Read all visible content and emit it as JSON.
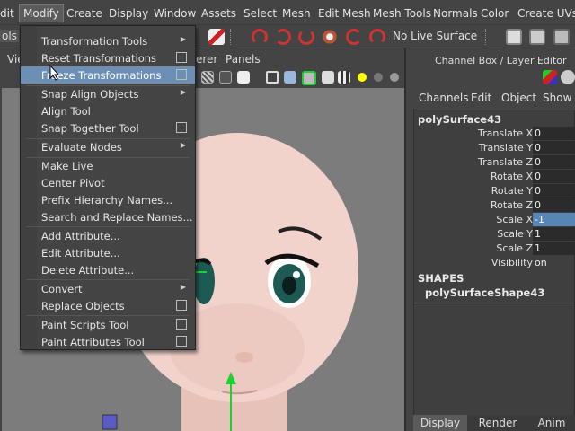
{
  "menubar": {
    "items": [
      "dit",
      "Modify",
      "Create",
      "Display",
      "Window",
      "Assets",
      "Select",
      "Mesh",
      "Edit Mesh",
      "Mesh Tools",
      "Normals",
      "Color",
      "Create UVs"
    ],
    "active": "Modify"
  },
  "statusbar": {
    "left_label": "ols",
    "live_surface": "No Live Surface"
  },
  "viewport_panel": {
    "menu": [
      "Vie",
      "erer",
      "Panels"
    ]
  },
  "modify_menu": {
    "items": [
      {
        "label": "Transformation Tools",
        "submenu": true,
        "option": false
      },
      {
        "label": "Reset Transformations",
        "submenu": false,
        "option": true
      },
      {
        "label": "Freeze Transformations",
        "submenu": false,
        "option": true,
        "highlighted": true
      },
      {
        "label": "Snap Align Objects",
        "submenu": true,
        "option": false
      },
      {
        "label": "Align Tool",
        "submenu": false,
        "option": false
      },
      {
        "label": "Snap Together Tool",
        "submenu": false,
        "option": true
      },
      {
        "label": "Evaluate Nodes",
        "submenu": true,
        "option": false
      },
      {
        "label": "Make Live",
        "submenu": false,
        "option": false
      },
      {
        "label": "Center Pivot",
        "submenu": false,
        "option": false
      },
      {
        "label": "Prefix Hierarchy Names...",
        "submenu": false,
        "option": false
      },
      {
        "label": "Search and Replace Names...",
        "submenu": false,
        "option": false
      },
      {
        "label": "Add Attribute...",
        "submenu": false,
        "option": false
      },
      {
        "label": "Edit Attribute...",
        "submenu": false,
        "option": false
      },
      {
        "label": "Delete Attribute...",
        "submenu": false,
        "option": false
      },
      {
        "label": "Convert",
        "submenu": true,
        "option": false
      },
      {
        "label": "Replace Objects",
        "submenu": false,
        "option": true
      },
      {
        "label": "Paint Scripts Tool",
        "submenu": false,
        "option": true
      },
      {
        "label": "Paint Attributes Tool",
        "submenu": false,
        "option": true
      }
    ]
  },
  "channel_box": {
    "title": "Channel Box / Layer Editor",
    "menu": [
      "Channels",
      "Edit",
      "Object",
      "Show"
    ],
    "object_name": "polySurface43",
    "attributes": [
      {
        "label": "Translate X",
        "value": "0"
      },
      {
        "label": "Translate Y",
        "value": "0"
      },
      {
        "label": "Translate Z",
        "value": "0"
      },
      {
        "label": "Rotate X",
        "value": "0"
      },
      {
        "label": "Rotate Y",
        "value": "0"
      },
      {
        "label": "Rotate Z",
        "value": "0"
      },
      {
        "label": "Scale X",
        "value": "-1",
        "selected": true
      },
      {
        "label": "Scale Y",
        "value": "1"
      },
      {
        "label": "Scale Z",
        "value": "1"
      },
      {
        "label": "Visibility",
        "value": "on"
      }
    ],
    "shapes_header": "SHAPES",
    "shape_name": "polySurfaceShape43",
    "tabs": [
      "Display",
      "Render",
      "Anim"
    ],
    "active_tab": "Display"
  },
  "icons": {
    "toolbar": [
      "snap-grid-icon",
      "snap-curve-icon",
      "snap-point-icon",
      "snap-view-icon",
      "make-live-icon",
      "render-icon",
      "ipr-icon",
      "render-settings-icon"
    ],
    "panel": [
      "wireframe-icon",
      "smooth-shade-icon",
      "xray-icon",
      "texture-icon",
      "light-icon",
      "shadow-icon"
    ]
  },
  "colors": {
    "menu_highlight": "#6e8fb4",
    "selected_value": "#5785b6",
    "viewport_bg": "#7c7c7c",
    "manipulator_green": "#19d233"
  }
}
